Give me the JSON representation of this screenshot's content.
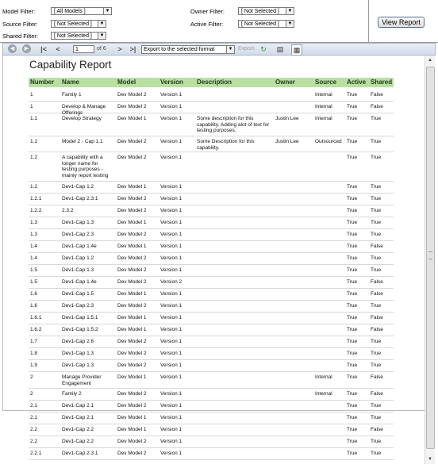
{
  "filters": {
    "model_label": "Model Filter:",
    "model_value": "[ All Models ]",
    "source_label": "Source Filter:",
    "source_value": "[ Not Selected ]",
    "shared_label": "Shared Filter:",
    "shared_value": "[ Not Selected ]",
    "owner_label": "Owner Filter:",
    "owner_value": "[ Not Selected ]",
    "active_label": "Active Filter:",
    "active_value": "[ Not Selected ]",
    "view_report": "View Report"
  },
  "toolbar": {
    "page": "1",
    "of_pages": "of 6",
    "export_format": "Export to the selected format",
    "export_link": "Export"
  },
  "report": {
    "title": "Capability Report",
    "headers": [
      "Number",
      "Name",
      "Model",
      "Version",
      "Description",
      "Owner",
      "Source",
      "Active",
      "Shared"
    ],
    "rows": [
      {
        "number": "1",
        "name": "Family 1",
        "model": "Dev Model 2",
        "version": "Version 1",
        "description": "",
        "owner": "",
        "source": "Internal",
        "active": "True",
        "shared": "False"
      },
      {
        "number": "1",
        "name": "Develop & Manage Offerings",
        "model": "Dev Model 2",
        "version": "Version 1",
        "description": "",
        "owner": "",
        "source": "Internal",
        "active": "True",
        "shared": "False"
      },
      {
        "number": "1.1",
        "name": "Develop Strategy",
        "model": "Dev Model 1",
        "version": "Version 1",
        "description": "Some description for this capability. Adding alot of text for testing purposes.",
        "owner": "Justin Lee",
        "source": "Internal",
        "active": "True",
        "shared": "True"
      },
      {
        "number": "1.1",
        "name": "Model 2 - Cap 1.1",
        "model": "Dev Model 2",
        "version": "Version 1",
        "description": "Some Description for this capability.",
        "owner": "Justin Lee",
        "source": "Outsourced",
        "active": "True",
        "shared": "True"
      },
      {
        "number": "1.2",
        "name": "A capability with a longer name for testing purposes - mainly report testing",
        "model": "Dev Model 2",
        "version": "Version 1",
        "description": "",
        "owner": "",
        "source": "",
        "active": "True",
        "shared": "True"
      },
      {
        "number": "1.2",
        "name": "Dev1-Cap 1.2",
        "model": "Dev Model 1",
        "version": "Version 1",
        "description": "",
        "owner": "",
        "source": "",
        "active": "True",
        "shared": "True"
      },
      {
        "number": "1.2.1",
        "name": "Dev1-Cap 2.3.1",
        "model": "Dev Model 2",
        "version": "Version 1",
        "description": "",
        "owner": "",
        "source": "",
        "active": "True",
        "shared": "True"
      },
      {
        "number": "1.2.2",
        "name": "2.3.2",
        "model": "Dev Model 2",
        "version": "Version 1",
        "description": "",
        "owner": "",
        "source": "",
        "active": "True",
        "shared": "True"
      },
      {
        "number": "1.3",
        "name": "Dev1-Cap 1.3",
        "model": "Dev Model 1",
        "version": "Version 1",
        "description": "",
        "owner": "",
        "source": "",
        "active": "True",
        "shared": "True"
      },
      {
        "number": "1.3",
        "name": "Dev1-Cap 2.3",
        "model": "Dev Model 2",
        "version": "Version 1",
        "description": "",
        "owner": "",
        "source": "",
        "active": "True",
        "shared": "True"
      },
      {
        "number": "1.4",
        "name": "Dev1-Cap 1.4e",
        "model": "Dev Model 1",
        "version": "Version 1",
        "description": "",
        "owner": "",
        "source": "",
        "active": "True",
        "shared": "False"
      },
      {
        "number": "1.4",
        "name": "Dev1-Cap 1.2",
        "model": "Dev Model 2",
        "version": "Version 1",
        "description": "",
        "owner": "",
        "source": "",
        "active": "True",
        "shared": "True"
      },
      {
        "number": "1.5",
        "name": "Dev1-Cap 1.3",
        "model": "Dev Model 2",
        "version": "Version 1",
        "description": "",
        "owner": "",
        "source": "",
        "active": "True",
        "shared": "True"
      },
      {
        "number": "1.5",
        "name": "Dev1-Cap 1.4e",
        "model": "Dev Model 2",
        "version": "Version 2",
        "description": "",
        "owner": "",
        "source": "",
        "active": "True",
        "shared": "False"
      },
      {
        "number": "1.6",
        "name": "Dev1-Cap 1.5",
        "model": "Dev Model 1",
        "version": "Version 1",
        "description": "",
        "owner": "",
        "source": "",
        "active": "True",
        "shared": "False"
      },
      {
        "number": "1.6",
        "name": "Dev1-Cap 2.3",
        "model": "Dev Model 2",
        "version": "Version 1",
        "description": "",
        "owner": "",
        "source": "",
        "active": "True",
        "shared": "True"
      },
      {
        "number": "1.6.1",
        "name": "Dev1-Cap 1.5.1",
        "model": "Dev Model 1",
        "version": "Version 1",
        "description": "",
        "owner": "",
        "source": "",
        "active": "True",
        "shared": "False"
      },
      {
        "number": "1.6.2",
        "name": "Dev1-Cap 1.5.2",
        "model": "Dev Model 1",
        "version": "Version 1",
        "description": "",
        "owner": "",
        "source": "",
        "active": "True",
        "shared": "False"
      },
      {
        "number": "1.7",
        "name": "Dev1-Cap 2.6",
        "model": "Dev Model 2",
        "version": "Version 1",
        "description": "",
        "owner": "",
        "source": "",
        "active": "True",
        "shared": "True"
      },
      {
        "number": "1.8",
        "name": "Dev1-Cap 1.3",
        "model": "Dev Model 2",
        "version": "Version 1",
        "description": "",
        "owner": "",
        "source": "",
        "active": "True",
        "shared": "True"
      },
      {
        "number": "1.9",
        "name": "Dev1-Cap 1.3",
        "model": "Dev Model 2",
        "version": "Version 1",
        "description": "",
        "owner": "",
        "source": "",
        "active": "True",
        "shared": "True"
      },
      {
        "number": "2",
        "name": "Manage Provider Engagement",
        "model": "Dev Model 1",
        "version": "Version 1",
        "description": "",
        "owner": "",
        "source": "Internal",
        "active": "True",
        "shared": "False"
      },
      {
        "number": "2",
        "name": "Family 2",
        "model": "Dev Model 2",
        "version": "Version 1",
        "description": "",
        "owner": "",
        "source": "Internal",
        "active": "True",
        "shared": "False"
      },
      {
        "number": "2.1",
        "name": "Dev1-Cap 2.1",
        "model": "Dev Model 2",
        "version": "Version 1",
        "description": "",
        "owner": "",
        "source": "",
        "active": "True",
        "shared": "True"
      },
      {
        "number": "2.1",
        "name": "Dev1-Cap 2.1",
        "model": "Dev Model 1",
        "version": "Version 1",
        "description": "",
        "owner": "",
        "source": "",
        "active": "True",
        "shared": "True"
      },
      {
        "number": "2.2",
        "name": "Dev1-Cap 2.2",
        "model": "Dev Model 1",
        "version": "Version 1",
        "description": "",
        "owner": "",
        "source": "",
        "active": "True",
        "shared": "False"
      },
      {
        "number": "2.2",
        "name": "Dev1-Cap 2.2",
        "model": "Dev Model 2",
        "version": "Version 1",
        "description": "",
        "owner": "",
        "source": "",
        "active": "True",
        "shared": "True"
      },
      {
        "number": "2.2.1",
        "name": "Dev1-Cap 2.3.1",
        "model": "Dev Model 2",
        "version": "Version 1",
        "description": "",
        "owner": "",
        "source": "",
        "active": "True",
        "shared": "True"
      }
    ]
  }
}
